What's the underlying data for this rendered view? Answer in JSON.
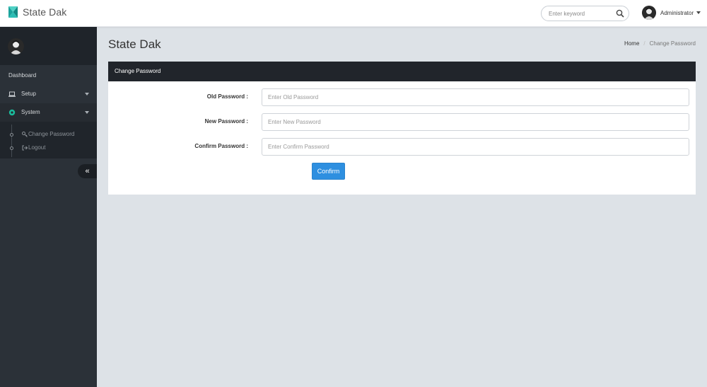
{
  "app": {
    "title": "State Dak",
    "brand_color": "#1bb8b0"
  },
  "header": {
    "search_placeholder": "Enter keyword",
    "user_name": "Administrator"
  },
  "sidebar": {
    "heading": "Dashboard",
    "items": [
      {
        "label": "Setup",
        "icon": "laptop-icon"
      },
      {
        "label": "System",
        "icon": "gear-icon",
        "active": true
      }
    ],
    "submenu": [
      {
        "label": "Change Password",
        "icon": "key-icon"
      },
      {
        "label": "Logout",
        "icon": "sign-out-icon"
      }
    ],
    "collapse_glyph": "«"
  },
  "page": {
    "title": "State Dak",
    "breadcrumb": {
      "home": "Home",
      "current": "Change Password"
    }
  },
  "panel": {
    "title": "Change Password",
    "fields": [
      {
        "label": "Old Password :",
        "placeholder": "Enter Old Password"
      },
      {
        "label": "New Password :",
        "placeholder": "Enter New Password"
      },
      {
        "label": "Confirm Password :",
        "placeholder": "Enter Confirm Password"
      }
    ],
    "submit_label": "Confirm"
  },
  "colors": {
    "sidebar_bg": "#2b3138",
    "panel_header_bg": "#21252b",
    "content_bg": "#dde2e7",
    "primary_button": "#2e8fe0",
    "system_icon": "#1abc9c"
  }
}
